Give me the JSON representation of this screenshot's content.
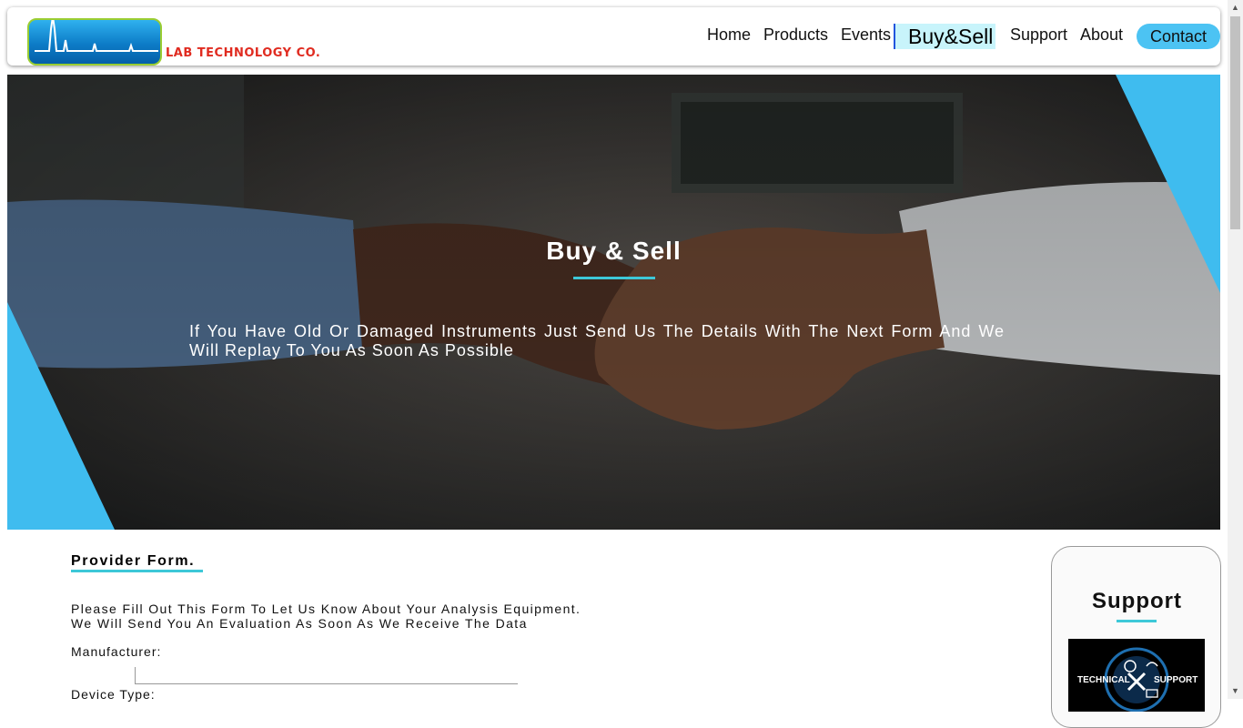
{
  "brand": {
    "name": "LAB TECHNOLOGY CO."
  },
  "nav": {
    "items": [
      "Home",
      "Products",
      "Events"
    ],
    "active": "Buy&Sell",
    "after": [
      "Support",
      "About"
    ],
    "contact": "Contact"
  },
  "hero": {
    "title": "Buy & Sell",
    "description": "If You Have Old Or Damaged Instruments Just Send Us The Details With The Next Form And We Will Replay To You As Soon As Possible"
  },
  "form": {
    "title": "Provider Form.",
    "intro_line1": "Please Fill Out This Form To Let Us Know About Your Analysis Equipment.",
    "intro_line2": "We Will Send You An Evaluation As Soon As We Receive The Data",
    "fields": [
      {
        "label": "Manufacturer:",
        "value": ""
      },
      {
        "label": "Device Type:",
        "value": ""
      }
    ]
  },
  "support": {
    "title": "Support",
    "image_text_left": "TECHNICAL",
    "image_text_right": "SUPPORT"
  },
  "colors": {
    "accent": "#3dc8d8",
    "contact_bg": "#4cc3f3",
    "active_bg": "#c8f4fb",
    "logo_text": "#e02b20"
  }
}
